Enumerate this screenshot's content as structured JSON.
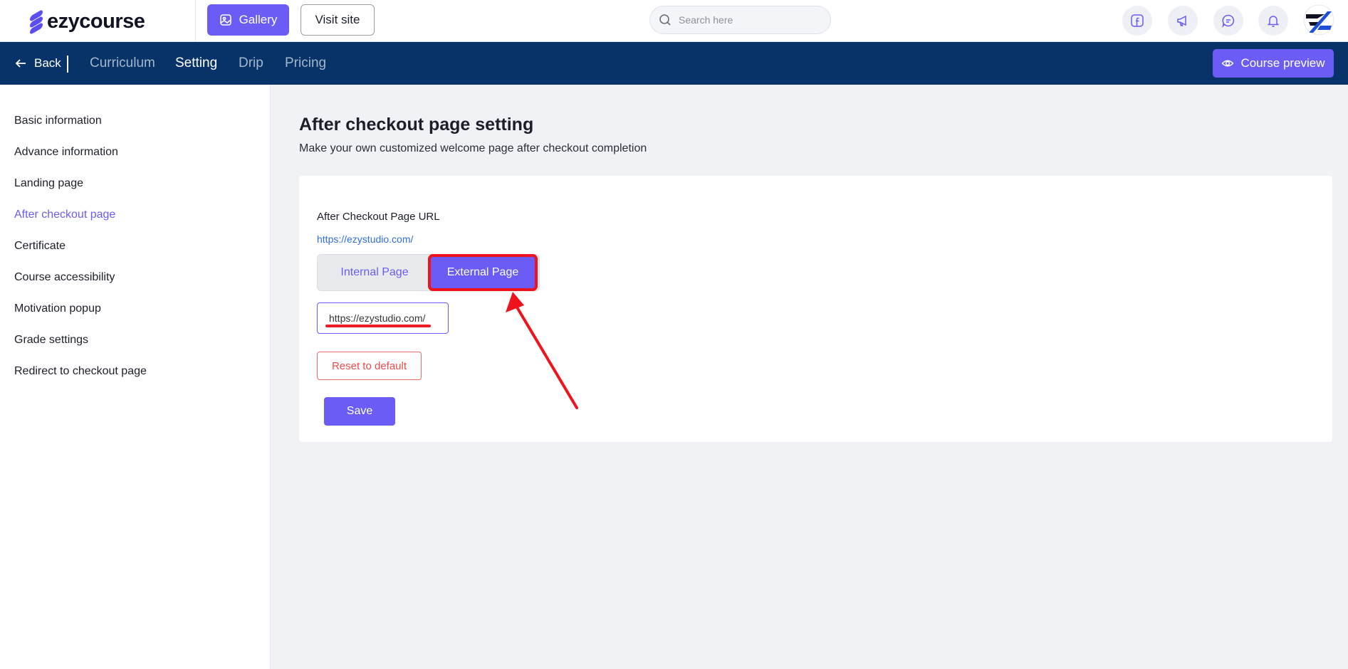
{
  "header": {
    "logo_text": "ezycourse",
    "gallery_label": "Gallery",
    "visit_site_label": "Visit site",
    "search_placeholder": "Search here",
    "icons": [
      "facebook-icon",
      "megaphone-icon",
      "chat-icon",
      "bell-icon"
    ]
  },
  "subnav": {
    "back_label": "Back",
    "tabs": [
      {
        "label": "Curriculum",
        "active": false
      },
      {
        "label": "Setting",
        "active": true
      },
      {
        "label": "Drip",
        "active": false
      },
      {
        "label": "Pricing",
        "active": false
      }
    ],
    "preview_label": "Course preview"
  },
  "sidebar": {
    "items": [
      {
        "label": "Basic information",
        "active": false
      },
      {
        "label": "Advance information",
        "active": false
      },
      {
        "label": "Landing page",
        "active": false
      },
      {
        "label": "After checkout page",
        "active": true
      },
      {
        "label": "Certificate",
        "active": false
      },
      {
        "label": "Course accessibility",
        "active": false
      },
      {
        "label": "Motivation popup",
        "active": false
      },
      {
        "label": "Grade settings",
        "active": false
      },
      {
        "label": "Redirect to checkout page",
        "active": false
      }
    ]
  },
  "main": {
    "title": "After checkout page setting",
    "subtitle": "Make your own customized welcome page after checkout completion",
    "field_label": "After Checkout Page URL",
    "field_link": "https://ezystudio.com/",
    "toggle": {
      "internal_label": "Internal Page",
      "external_label": "External Page",
      "selected": "External Page"
    },
    "url_value": "https://ezystudio.com/",
    "reset_label": "Reset to default",
    "save_label": "Save"
  },
  "colors": {
    "accent": "#6a5cf5",
    "navbar": "#073369",
    "annotation": "#f0121c"
  }
}
